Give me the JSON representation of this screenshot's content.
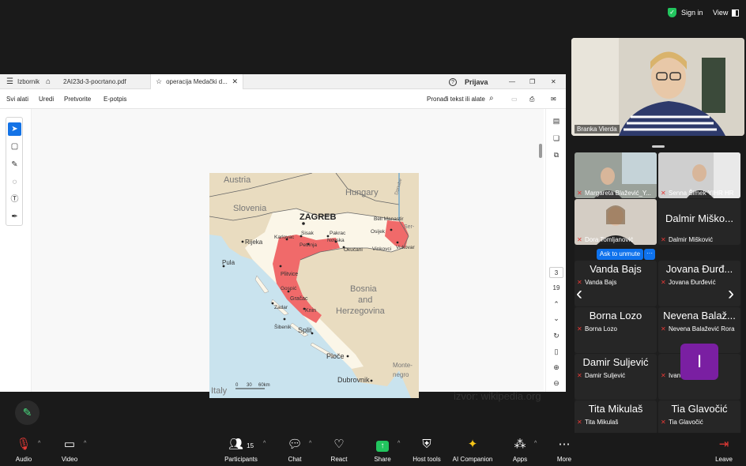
{
  "topbar": {
    "signin_label": "Sign in",
    "view_label": "View"
  },
  "pdf": {
    "menu_label": "Izbornik",
    "tabs": [
      {
        "label": "2AI23d-3-pocrtano.pdf"
      },
      {
        "label": "operacija Medački d..."
      }
    ],
    "login_label": "Prijava",
    "toolbar": {
      "all_tools": "Svi alati",
      "edit": "Uredi",
      "convert": "Pretvorite",
      "esign": "E-potpis",
      "find_label": "Pronađi tekst ili alate"
    },
    "page_current": "3",
    "page_total": "19",
    "map_labels": {
      "austria": "Austria",
      "hungary": "Hungary",
      "slovenia": "Slovenia",
      "zagreb": "ZAGREB",
      "beli_manastir": "Beli Manastir",
      "osijek": "Osijek",
      "sisak": "Sisak",
      "pakrac": "Pakrac",
      "karlovac": "Karlovac",
      "petrinja": "Petrinja",
      "novska": "Novska",
      "okucani": "Okučani",
      "vinkovci": "Vinkovci",
      "vukovar": "Vukovar",
      "rijeka": "Rijeka",
      "pula": "Pula",
      "plitvice": "Plitvice",
      "gospic": "Gospić",
      "gracac": "Gračac",
      "zadar": "Zadar",
      "knin": "Knin",
      "sibenik": "Šibenik",
      "split": "Split",
      "bosnia": "Bosnia",
      "and": "and",
      "herzegovina": "Herzegovina",
      "ploce": "Ploče",
      "monte": "Monte-",
      "negro": "negro",
      "dubrovnik": "Dubrovnik",
      "italy": "Italy",
      "danube": "Danube",
      "ser": "Ser-",
      "scale_0": "0",
      "scale_30": "30",
      "scale_60": "60km"
    },
    "source_text": "izvor: wikipedia.org"
  },
  "speaker": {
    "name": "Branka Vierda"
  },
  "gallery": {
    "tiles": [
      {
        "big": "",
        "label": "Margareta Blažević_Y..."
      },
      {
        "big": "",
        "label": "Senna Šimek YIHR HR"
      },
      {
        "big": "",
        "label": "Dora Tomljanović"
      },
      {
        "big": "Dalmir Miško...",
        "label": "Dalmir Mišković"
      },
      {
        "big": "Vanda Bajs",
        "label": "Vanda Bajs"
      },
      {
        "big": "Jovana Đurđ...",
        "label": "Jovana Đurđević"
      },
      {
        "big": "Borna Lozo",
        "label": "Borna Lozo"
      },
      {
        "big": "Nevena Balaž...",
        "label": "Nevena Balažević Rora"
      },
      {
        "big": "Damir Suljević",
        "label": "Damir Suljević"
      },
      {
        "big": "",
        "label": "Ivan Podnar",
        "avatar": "I"
      },
      {
        "big": "Tita Mikulaš",
        "label": "Tita Mikulaš"
      },
      {
        "big": "Tia Glavočić",
        "label": "Tia Glavočić"
      }
    ],
    "ask_unmute": "Ask to unmute",
    "more": "···"
  },
  "controls": {
    "audio": "Audio",
    "video": "Video",
    "participants": "Participants",
    "participants_count": "15",
    "chat": "Chat",
    "react": "React",
    "share": "Share",
    "host_tools": "Host tools",
    "ai_companion": "AI Companion",
    "apps": "Apps",
    "more": "More",
    "leave": "Leave"
  },
  "colors": {
    "zoom_blue": "#0e72ed",
    "green": "#22c55e",
    "avatar_purple": "#7a1fa2",
    "occupied_red": "#f06a6a",
    "sea": "#c9e3ee",
    "land": "#f3e9d0"
  }
}
